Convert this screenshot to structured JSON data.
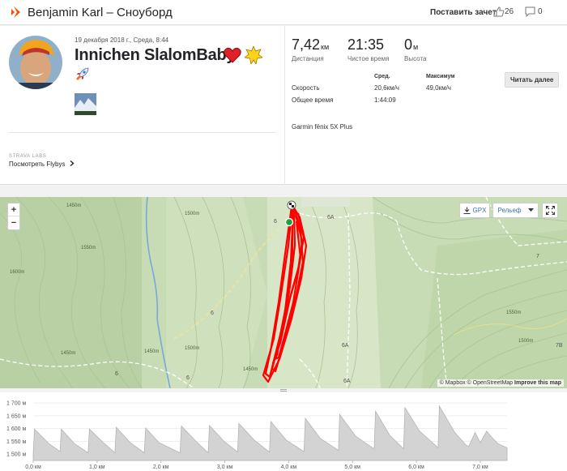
{
  "header": {
    "title": "Benjamin Karl – Сноуборд",
    "praise_label": "Поставить зачет",
    "kudos_count": "26",
    "comments_count": "0"
  },
  "activity": {
    "date": "19 декабря 2018 г., Среда, 8:44",
    "name": "Innichen SlalomBaby",
    "labs_label": "STRAVA LABS",
    "flyby_link": "Посмотреть Flybys"
  },
  "stats": {
    "distance_value": "7,42",
    "distance_unit": "км",
    "distance_label": "Дистанция",
    "moving_time_value": "21:35",
    "moving_time_label": "Чистое время",
    "elevation_value": "0",
    "elevation_unit": "м",
    "elevation_label": "Высота",
    "read_more": "Читать далее",
    "col_avg": "Сред.",
    "col_max": "Максимум",
    "speed_label": "Скорость",
    "speed_avg": "20,6км/ч",
    "speed_max": "49,0км/ч",
    "total_time_label": "Общее время",
    "total_time": "1:44:09",
    "device": "Garmin fēnix 5X Plus"
  },
  "map": {
    "zoom_in": "+",
    "zoom_out": "−",
    "gpx_label": "GPX",
    "relief_label": "Рельеф",
    "attribution_mapbox": "© Mapbox",
    "attribution_osm": "© OpenStreetMap",
    "attribution_improve": "Improve this map",
    "labels": {
      "r6a": "6A",
      "r6a2": "6A",
      "r6a3": "6A",
      "r6": "6",
      "r6b": "6",
      "r6c": "6",
      "r6d": "6",
      "r7": "7",
      "r7b": "7B",
      "c1": "1450m",
      "c2": "1500m",
      "c3": "1550m",
      "c4": "1600m",
      "c5": "1450m",
      "c6": "1550m",
      "c7": "1450m",
      "c8": "1500m",
      "c9": "1450m",
      "c10": "1500m"
    },
    "route_color": "#ff0000"
  },
  "chart_data": {
    "type": "area",
    "title": "",
    "xlabel": "",
    "ylabel": "",
    "y_ticks": [
      "1 700 м",
      "1 650 м",
      "1 600 м",
      "1 550 м",
      "1 500 м"
    ],
    "x_ticks": [
      "0,0 км",
      "1,0 км",
      "2,0 км",
      "3,0 км",
      "4,0 км",
      "5,0 км",
      "6,0 км",
      "7,0 км"
    ],
    "xlim": [
      0,
      7.42
    ],
    "ylim": [
      1475,
      1710
    ],
    "x": [
      0.0,
      0.02,
      0.25,
      0.42,
      0.44,
      0.65,
      0.86,
      0.88,
      1.1,
      1.28,
      1.3,
      1.52,
      1.74,
      1.76,
      1.97,
      2.3,
      2.32,
      2.55,
      2.74,
      2.76,
      2.98,
      3.2,
      3.22,
      3.46,
      3.7,
      3.72,
      3.96,
      4.24,
      4.26,
      4.5,
      4.78,
      4.8,
      5.05,
      5.34,
      5.36,
      5.58,
      5.8,
      5.82,
      6.05,
      6.34,
      6.36,
      6.6,
      6.78,
      6.82,
      6.92,
      7.0,
      7.1,
      7.2,
      7.28,
      7.42
    ],
    "y": [
      1500,
      1598,
      1540,
      1510,
      1598,
      1540,
      1505,
      1598,
      1545,
      1505,
      1605,
      1545,
      1505,
      1602,
      1545,
      1505,
      1610,
      1550,
      1505,
      1612,
      1552,
      1508,
      1620,
      1555,
      1508,
      1628,
      1555,
      1510,
      1640,
      1560,
      1515,
      1655,
      1570,
      1520,
      1668,
      1575,
      1520,
      1682,
      1590,
      1525,
      1688,
      1585,
      1535,
      1530,
      1585,
      1545,
      1590,
      1560,
      1540,
      1525
    ],
    "fill_color": "#d3d3d3",
    "line_color": "#b5b5b5"
  }
}
